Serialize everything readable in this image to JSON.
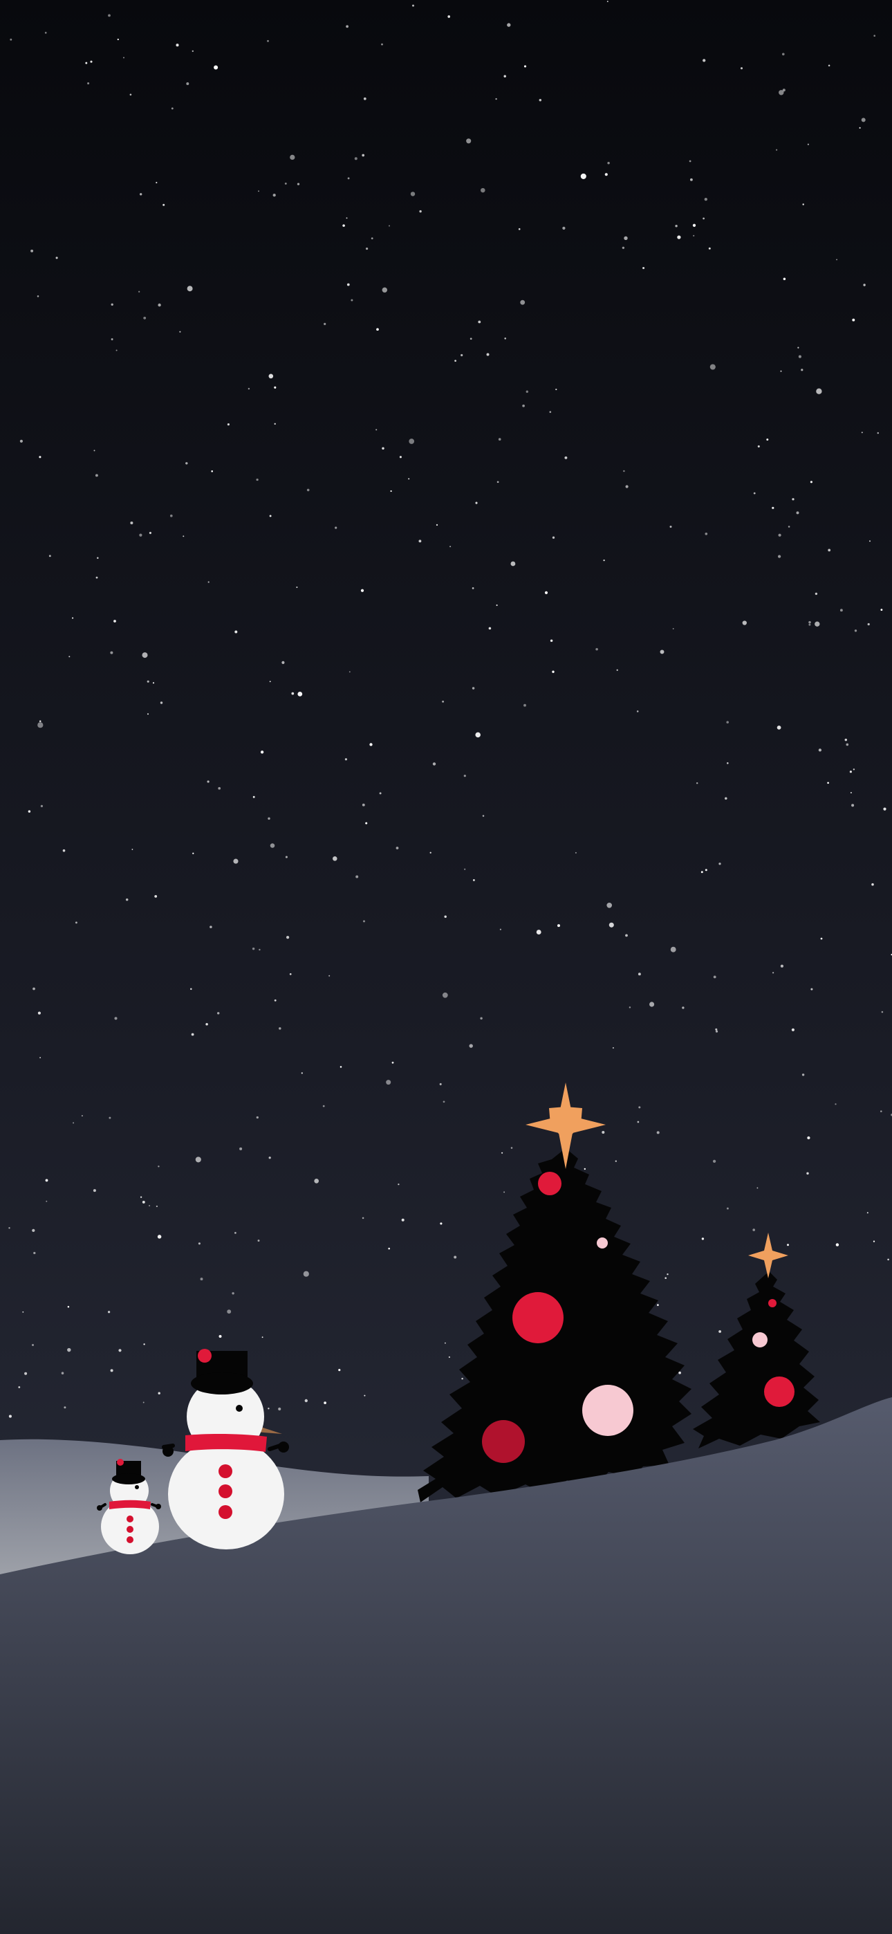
{
  "scene": {
    "kind": "wallpaper",
    "subject": "night-sky-snow-hills-christmas-trees-snowmen",
    "elements": [
      "star-field-icon",
      "snow-hill-icon",
      "christmas-tree-icon",
      "tree-star-icon",
      "ornament-icon",
      "snowman-icon",
      "top-hat-icon",
      "scarf-icon",
      "carrot-nose-icon"
    ]
  },
  "colors": {
    "sky_top": "#08090d",
    "sky_mid": "#1a1c26",
    "sky_bottom": "#2e3240",
    "star": "#ffffff",
    "back_hill": "#6d7282",
    "front_hill_top": "#565b6d",
    "front_hill_bottom": "#23262f",
    "tree": "#050505",
    "tree_star": "#f0a05e",
    "ornament_red": "#e01a3a",
    "ornament_dark_red": "#b0122d",
    "ornament_pink": "#f7c9d2",
    "snowman_body": "#f4f4f4",
    "snowman_scarf": "#e0173a",
    "snowman_buttons": "#d4102e",
    "hat": "#050505",
    "carrot": "#9a6a45"
  }
}
